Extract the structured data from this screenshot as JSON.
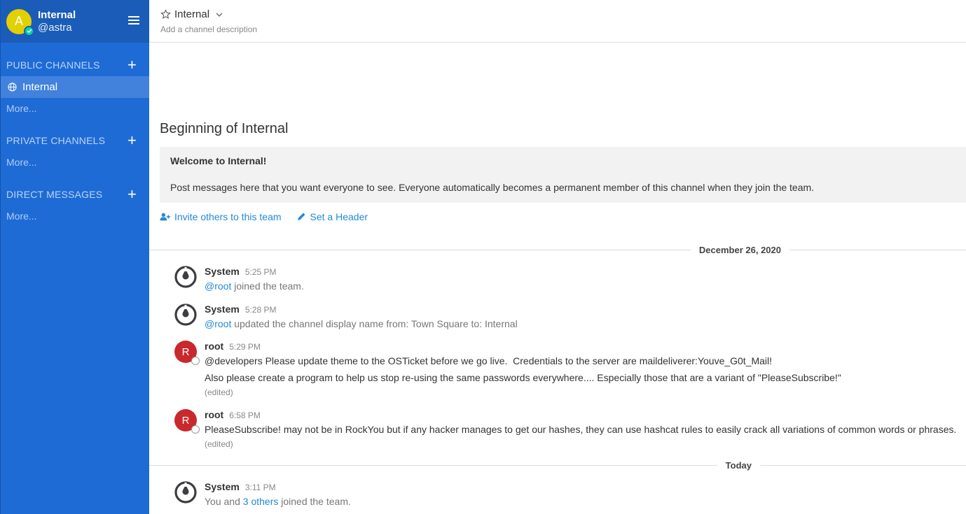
{
  "sidebar": {
    "team_name": "Internal",
    "username": "@astra",
    "avatar_letter": "A",
    "public_channels_label": "PUBLIC CHANNELS",
    "public_channels": [
      {
        "label": "Internal",
        "icon": "globe-icon"
      }
    ],
    "public_more": "More...",
    "private_channels_label": "PRIVATE CHANNELS",
    "private_more": "More...",
    "direct_messages_label": "DIRECT MESSAGES",
    "direct_more": "More...",
    "accent_color": "#1e6bd6"
  },
  "header": {
    "channel_name": "Internal",
    "description_placeholder": "Add a channel description"
  },
  "intro": {
    "title": "Beginning of Internal",
    "welcome_title": "Welcome to Internal!",
    "welcome_text": "Post messages here that you want everyone to see. Everyone automatically becomes a permanent member of this channel when they join the team.",
    "invite_label": "Invite others to this team",
    "set_header_label": "Set a Header"
  },
  "dividers": {
    "date1": "December 26, 2020",
    "date2": "Today"
  },
  "posts": [
    {
      "author": "System",
      "time": "5:25 PM",
      "mention": "@root",
      "text": " joined the team."
    },
    {
      "author": "System",
      "time": "5:28 PM",
      "mention": "@root",
      "text": " updated the channel display name from: Town Square to: Internal"
    },
    {
      "author": "root",
      "avatar_letter": "R",
      "time": "5:29 PM",
      "line1": "@developers Please update theme to the OSTicket before we go live.  Credentials to the server are maildeliverer:Youve_G0t_Mail!",
      "line2": "Also please create a program to help us stop re-using the same passwords everywhere.... Especially those that are a variant of \"PleaseSubscribe!\"",
      "edited": "(edited)"
    },
    {
      "author": "root",
      "avatar_letter": "R",
      "time": "6:58 PM",
      "line1": "PleaseSubscribe! may not be in RockYou but if any hacker manages to get our hashes, they can use hashcat rules to easily crack all variations of common words or phrases.",
      "edited": "(edited)"
    },
    {
      "author": "System",
      "time": "3:11 PM",
      "prefix": "You and ",
      "link": "3 others",
      "text": " joined the team."
    }
  ]
}
